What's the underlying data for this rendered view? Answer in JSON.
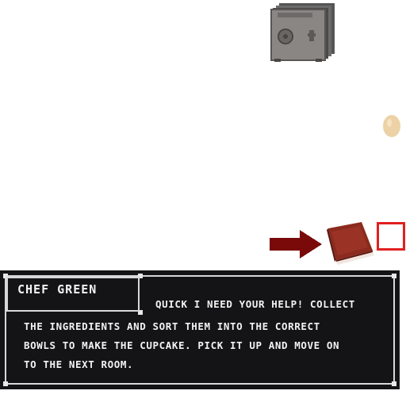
{
  "scene": {
    "objects": [
      {
        "name": "safe",
        "icon": "safe-icon"
      },
      {
        "name": "egg",
        "icon": "egg-icon"
      },
      {
        "name": "arrow",
        "icon": "right-arrow-icon",
        "color": "#7a0a0a"
      },
      {
        "name": "recipe-book",
        "icon": "book-icon",
        "color": "#8b2a1e"
      },
      {
        "name": "inventory-slot",
        "icon": "selection-box",
        "color": "#e02020"
      }
    ]
  },
  "dialog": {
    "speaker": "CHEF GREEN",
    "lines": [
      "QUICK I NEED YOUR HELP! COLLECT",
      "THE INGREDIENTS AND SORT THEM INTO THE CORRECT",
      "BOWLS TO MAKE THE CUPCAKE. PICK IT UP AND MOVE ON",
      "TO THE NEXT ROOM."
    ],
    "background": "#141416",
    "border": "#d8d8d8"
  }
}
